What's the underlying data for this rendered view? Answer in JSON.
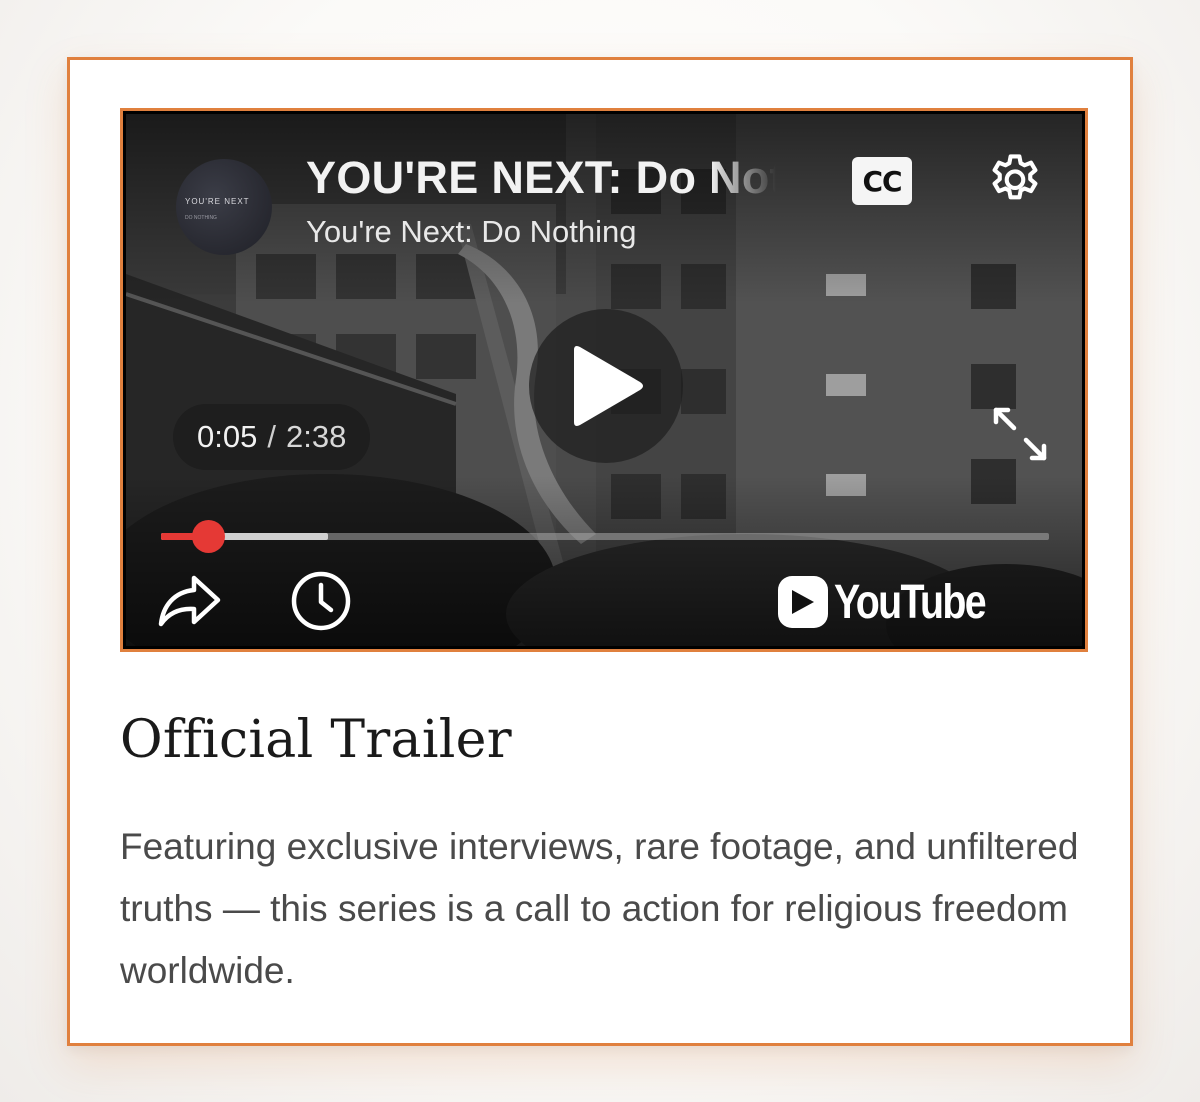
{
  "video": {
    "title": "YOU'RE NEXT: Do Nothing",
    "channel": "You're Next: Do Nothing",
    "avatar_title": "YOU'RE NEXT",
    "avatar_subtitle": "DO NOTHING",
    "captions_label": "CC",
    "current_time": "0:05",
    "separator": "/",
    "duration": "2:38",
    "played_fraction": 0.053,
    "buffered_fraction": 0.188,
    "brand": "YouTube",
    "icons": [
      "gear-icon",
      "play-icon",
      "fullscreen-icon",
      "share-icon",
      "watch-later-icon",
      "youtube-logo"
    ]
  },
  "heading": "Official Trailer",
  "description": "Featuring exclusive interviews, rare footage, and unfiltered truths — this series is a call to action for religious freedom worldwide.",
  "colors": {
    "accent": "#e0803e",
    "progress_played": "#e53935",
    "heading_text": "#1a1a1a",
    "body_text": "#4a4a4a"
  }
}
